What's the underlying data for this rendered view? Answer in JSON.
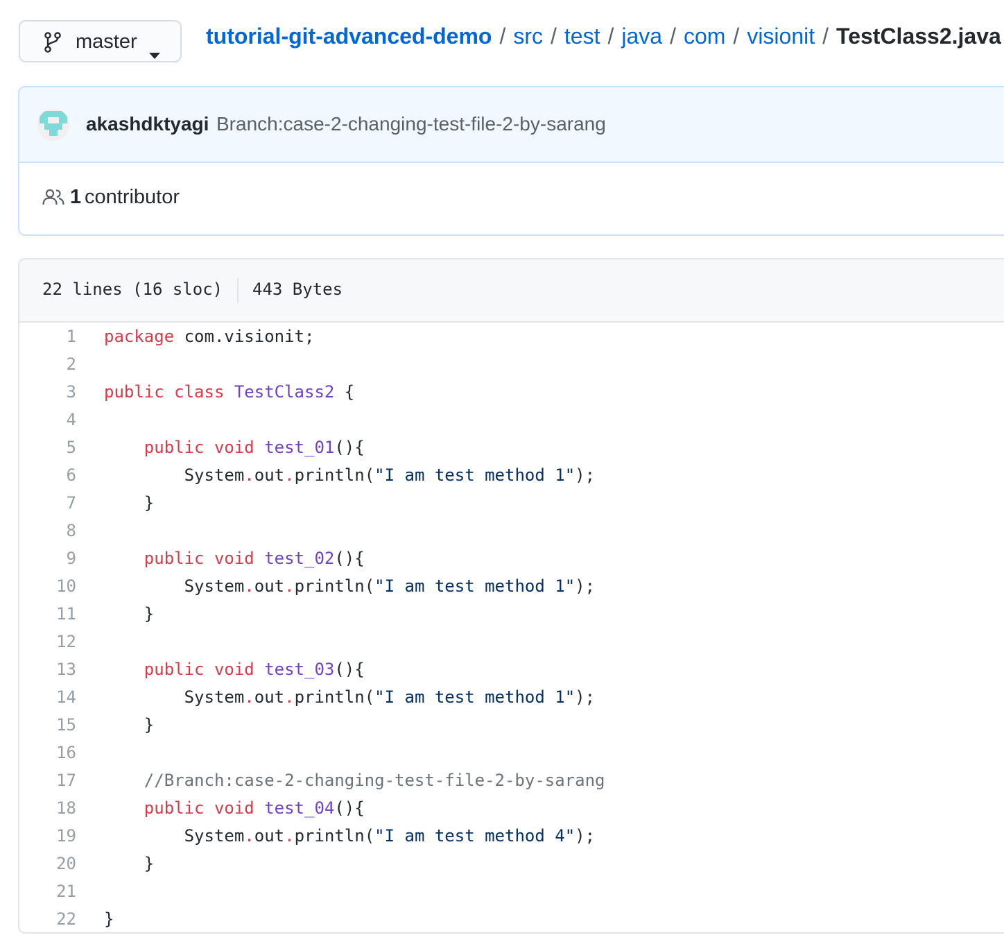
{
  "branch_selector": {
    "label": "master",
    "icon": "git-branch-icon"
  },
  "breadcrumb": {
    "repo": "tutorial-git-advanced-demo",
    "segments": [
      "src",
      "test",
      "java",
      "com",
      "visionit"
    ],
    "separator": "/",
    "file": "TestClass2.java"
  },
  "commit": {
    "author": "akashdktyagi",
    "message": "Branch:case-2-changing-test-file-2-by-sarang"
  },
  "contributors": {
    "count": "1",
    "label": "contributor"
  },
  "file_info": {
    "lines": "22 lines (16 sloc)",
    "size": "443 Bytes"
  },
  "code": {
    "line_numbers": [
      "1",
      "2",
      "3",
      "4",
      "5",
      "6",
      "7",
      "8",
      "9",
      "10",
      "11",
      "12",
      "13",
      "14",
      "15",
      "16",
      "17",
      "18",
      "19",
      "20",
      "21",
      "22"
    ],
    "lines": [
      [
        [
          "k",
          "package"
        ],
        [
          "p",
          " com.visionit;"
        ]
      ],
      [],
      [
        [
          "k",
          "public"
        ],
        [
          "p",
          " "
        ],
        [
          "k",
          "class"
        ],
        [
          "p",
          " "
        ],
        [
          "en",
          "TestClass2"
        ],
        [
          "p",
          " {"
        ]
      ],
      [],
      [
        [
          "p",
          "    "
        ],
        [
          "k",
          "public"
        ],
        [
          "p",
          " "
        ],
        [
          "k",
          "void"
        ],
        [
          "p",
          " "
        ],
        [
          "en",
          "test_01"
        ],
        [
          "p",
          "(){"
        ]
      ],
      [
        [
          "p",
          "        System"
        ],
        [
          "k",
          "."
        ],
        [
          "p",
          "out"
        ],
        [
          "k",
          "."
        ],
        [
          "p",
          "println("
        ],
        [
          "s",
          "\"I am test method 1\""
        ],
        [
          "p",
          ");"
        ]
      ],
      [
        [
          "p",
          "    }"
        ]
      ],
      [],
      [
        [
          "p",
          "    "
        ],
        [
          "k",
          "public"
        ],
        [
          "p",
          " "
        ],
        [
          "k",
          "void"
        ],
        [
          "p",
          " "
        ],
        [
          "en",
          "test_02"
        ],
        [
          "p",
          "(){"
        ]
      ],
      [
        [
          "p",
          "        System"
        ],
        [
          "k",
          "."
        ],
        [
          "p",
          "out"
        ],
        [
          "k",
          "."
        ],
        [
          "p",
          "println("
        ],
        [
          "s",
          "\"I am test method 1\""
        ],
        [
          "p",
          ");"
        ]
      ],
      [
        [
          "p",
          "    }"
        ]
      ],
      [],
      [
        [
          "p",
          "    "
        ],
        [
          "k",
          "public"
        ],
        [
          "p",
          " "
        ],
        [
          "k",
          "void"
        ],
        [
          "p",
          " "
        ],
        [
          "en",
          "test_03"
        ],
        [
          "p",
          "(){"
        ]
      ],
      [
        [
          "p",
          "        System"
        ],
        [
          "k",
          "."
        ],
        [
          "p",
          "out"
        ],
        [
          "k",
          "."
        ],
        [
          "p",
          "println("
        ],
        [
          "s",
          "\"I am test method 1\""
        ],
        [
          "p",
          ");"
        ]
      ],
      [
        [
          "p",
          "    }"
        ]
      ],
      [],
      [
        [
          "p",
          "    "
        ],
        [
          "c",
          "//Branch:case-2-changing-test-file-2-by-sarang"
        ]
      ],
      [
        [
          "p",
          "    "
        ],
        [
          "k",
          "public"
        ],
        [
          "p",
          " "
        ],
        [
          "k",
          "void"
        ],
        [
          "p",
          " "
        ],
        [
          "en",
          "test_04"
        ],
        [
          "p",
          "(){"
        ]
      ],
      [
        [
          "p",
          "        System"
        ],
        [
          "k",
          "."
        ],
        [
          "p",
          "out"
        ],
        [
          "k",
          "."
        ],
        [
          "p",
          "println("
        ],
        [
          "s",
          "\"I am test method 4\""
        ],
        [
          "p",
          ");"
        ]
      ],
      [
        [
          "p",
          "    }"
        ]
      ],
      [],
      [
        [
          "p",
          "}"
        ]
      ]
    ]
  },
  "colors": {
    "link": "#0366d6",
    "keyword": "#d73a49",
    "entity": "#6f42c1",
    "string": "#032f62",
    "comment": "#6a737d",
    "commit_bg": "#f1f8ff"
  }
}
